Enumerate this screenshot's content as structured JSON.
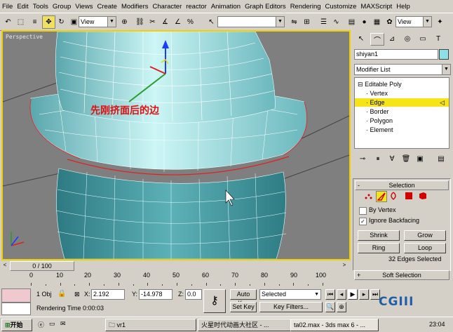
{
  "menu": [
    "File",
    "Edit",
    "Tools",
    "Group",
    "Views",
    "Create",
    "Modifiers",
    "Character",
    "reactor",
    "Animation",
    "Graph Editors",
    "Rendering",
    "Customize",
    "MAXScript",
    "Help"
  ],
  "toolbar": {
    "ref_coord": "View",
    "named_sel": "",
    "view_combo": "View"
  },
  "viewport": {
    "label": "Perspective",
    "annotation": "先刚挤面后的边",
    "colors": {
      "mesh": "#8fe4e6",
      "mesh_dark": "#3e8f97",
      "edge": "#ffffff",
      "border": "#f0d000",
      "annotation": "#e01010"
    }
  },
  "command_panel": {
    "object_name": "shiyan1",
    "modifier_list": "Modifier List",
    "stack": [
      "Editable Poly",
      "Vertex",
      "Edge",
      "Border",
      "Polygon",
      "Element"
    ],
    "selected_stack": "Edge",
    "selection_rollout": {
      "title": "Selection",
      "by_vertex": "By Vertex",
      "ignore_backfacing": "Ignore Backfacing",
      "ignore_backfacing_checked": true,
      "shrink": "Shrink",
      "grow": "Grow",
      "ring": "Ring",
      "loop": "Loop",
      "status": "32 Edges Selected"
    },
    "soft_selection": "Soft Selection"
  },
  "time_slider": {
    "label": "0 / 100",
    "current": 0,
    "total": 100
  },
  "trackbar": {
    "ticks": [
      "0",
      "10",
      "20",
      "30",
      "40",
      "50",
      "60",
      "70",
      "80",
      "90",
      "100"
    ]
  },
  "status_bar": {
    "objects": "1 Obj",
    "x_label": "X:",
    "x": "2.192",
    "y_label": "Y:",
    "y": "-14.978",
    "z_label": "Z:",
    "z": "0.0",
    "auto_key": "Auto Key",
    "set_key": "Set Key",
    "selected": "Selected",
    "key_filters": "Key Filters...",
    "render_time": "Rendering Time  0:00:03"
  },
  "watermark": "CGIII",
  "taskbar": {
    "start": "开始",
    "tasks": [
      "vr1",
      "火星时代动画大社区 - ...",
      "ta02.max - 3ds max 6 - ..."
    ],
    "clock": "23:04"
  }
}
